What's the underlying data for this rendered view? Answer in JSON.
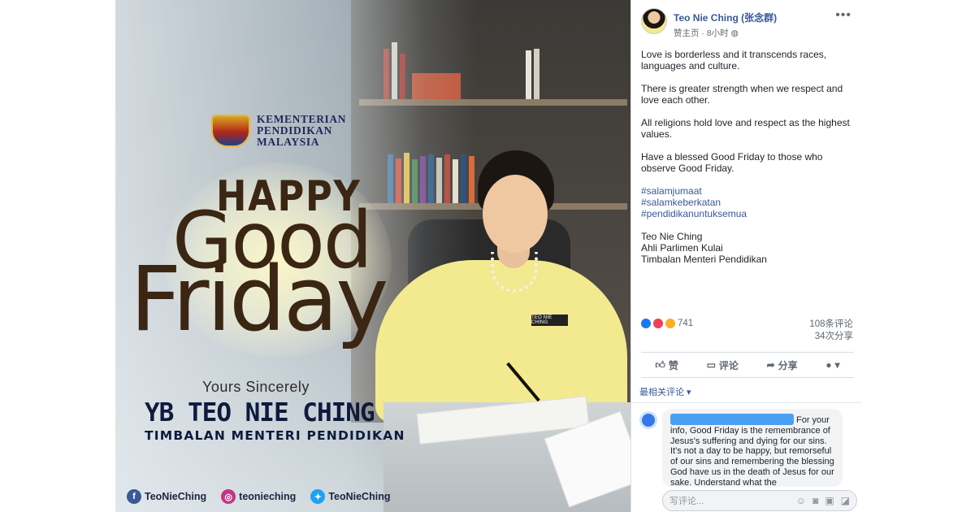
{
  "image": {
    "ministry_lines": [
      "KEMENTERIAN",
      "PENDIDIKAN",
      "MALAYSIA"
    ],
    "greeting_1": "HAPPY",
    "greeting_2": "Good",
    "greeting_3": "Friday",
    "yours": "Yours Sincerely",
    "name": "YB TEO NIE CHING",
    "subtitle": "TIMBALAN MENTERI PENDIDIKAN",
    "name_tag": "TEO NIE CHING",
    "socials": [
      {
        "icon": "facebook-icon",
        "label": "TeoNieChing",
        "color": "#3b5998"
      },
      {
        "icon": "instagram-icon",
        "label": "teonieching",
        "color": "#c13584"
      },
      {
        "icon": "twitter-icon",
        "label": "TeoNieChing",
        "color": "#1da1f2"
      }
    ]
  },
  "post": {
    "author": "Teo Nie Ching (张念群)",
    "meta_sponsor": "赞主页",
    "meta_time": "8小时",
    "paragraphs": [
      "Love is borderless and it transcends races, languages and culture.",
      "There is greater strength when we respect and love each other.",
      "All religions hold love and respect as the highest values.",
      "Have a blessed Good Friday to those who observe Good Friday."
    ],
    "hashtags": [
      "#salamjumaat",
      "#salamkeberkatan",
      "#pendidikanuntuksemua"
    ],
    "signature": [
      "Teo Nie Ching",
      "Ahli Parlimen Kulai",
      "Timbalan Menteri Pendidikan"
    ],
    "reaction_count": "741",
    "comment_count": "108条评论",
    "share_count": "34次分享",
    "actions": {
      "like": "赞",
      "comment": "评论",
      "share": "分享"
    },
    "sort_label": "最相关评论 ▾",
    "comment_text": "For your info, Good Friday is the remembrance of Jesus's suffering and dying for our sins. It's not a day to be happy, but remorseful of our sins and remembering the blessing God have us in the death of Jesus for our sake. Understand what the",
    "compose_placeholder": "写评论..."
  }
}
